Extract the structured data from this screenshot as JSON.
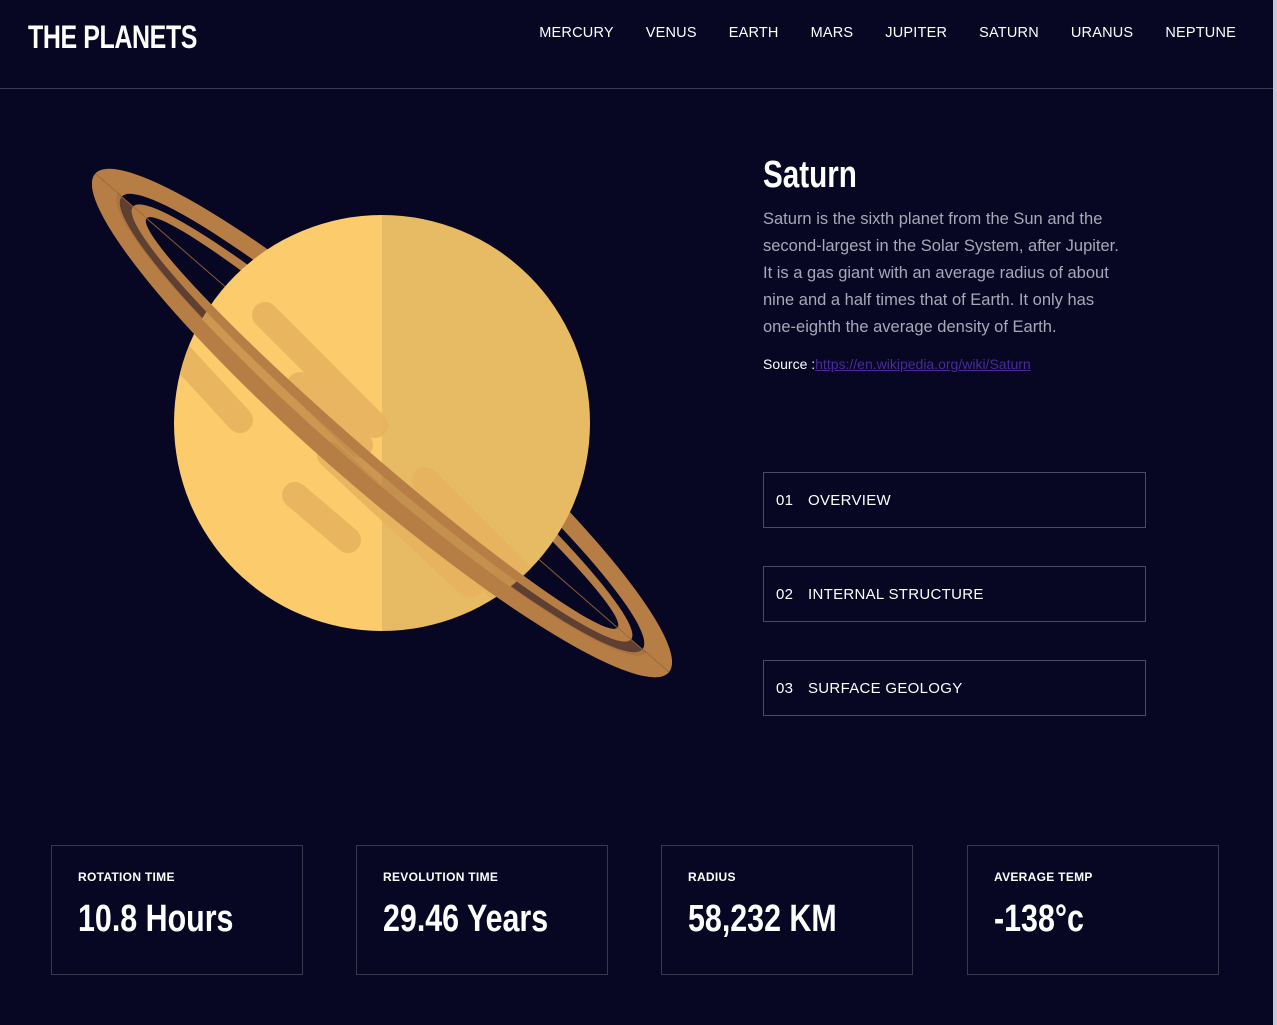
{
  "header": {
    "logo": "THE PLANETS",
    "nav": [
      "MERCURY",
      "VENUS",
      "EARTH",
      "MARS",
      "JUPITER",
      "SATURN",
      "URANUS",
      "NEPTUNE"
    ]
  },
  "planet": {
    "name": "Saturn",
    "description": "Saturn is the sixth planet from the Sun and the second-largest in the Solar System, after Jupiter. It is a gas giant with an average radius of about nine and a half times that of Earth. It only has one-eighth the average density of Earth.",
    "source_label": "Source :",
    "source_link": "https://en.wikipedia.org/wiki/Saturn"
  },
  "tabs": [
    {
      "num": "01",
      "label": "OVERVIEW"
    },
    {
      "num": "02",
      "label": "INTERNAL STRUCTURE"
    },
    {
      "num": "03",
      "label": "SURFACE GEOLOGY"
    }
  ],
  "stats": [
    {
      "label": "ROTATION TIME",
      "value": "10.8 Hours"
    },
    {
      "label": "REVOLUTION TIME",
      "value": "29.46 Years"
    },
    {
      "label": "RADIUS",
      "value": "58,232 KM"
    },
    {
      "label": "AVERAGE TEMP",
      "value": "-138°c"
    }
  ],
  "colors": {
    "background": "#070724",
    "planet_light": "#FCCB6B",
    "planet_dark": "#E7BA64",
    "ring": "#B67D45",
    "border": "#38384F"
  }
}
